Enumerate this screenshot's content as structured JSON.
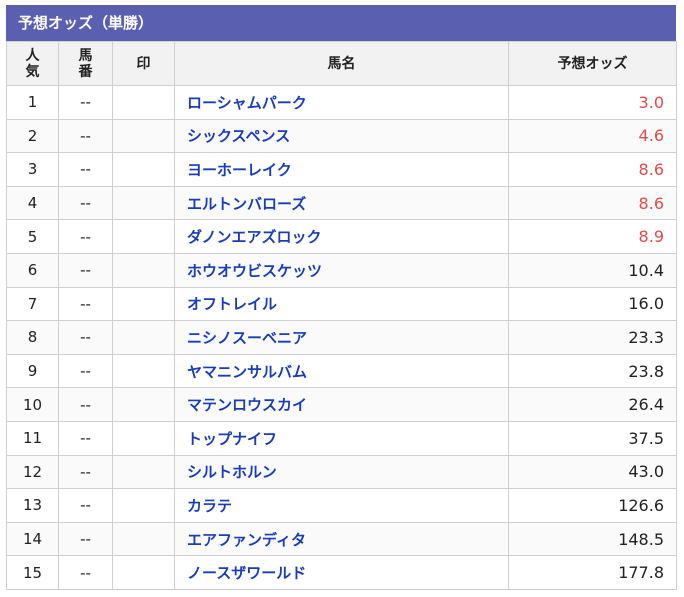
{
  "title": "予想オッズ（単勝）",
  "headers": {
    "rank_line1": "人",
    "rank_line2": "気",
    "num_line1": "馬",
    "num_line2": "番",
    "mark": "印",
    "name": "馬名",
    "odds": "予想オッズ"
  },
  "colors": {
    "header_bar": "#5a5fb0",
    "horse_name": "#1a3cb4",
    "hot_odds": "#e04a4a"
  },
  "rows": [
    {
      "rank": "1",
      "num": "--",
      "mark": "",
      "name": "ローシャムパーク",
      "odds": "3.0",
      "hot": true
    },
    {
      "rank": "2",
      "num": "--",
      "mark": "",
      "name": "シックスペンス",
      "odds": "4.6",
      "hot": true
    },
    {
      "rank": "3",
      "num": "--",
      "mark": "",
      "name": "ヨーホーレイク",
      "odds": "8.6",
      "hot": true
    },
    {
      "rank": "4",
      "num": "--",
      "mark": "",
      "name": "エルトンバローズ",
      "odds": "8.6",
      "hot": true
    },
    {
      "rank": "5",
      "num": "--",
      "mark": "",
      "name": "ダノンエアズロック",
      "odds": "8.9",
      "hot": true
    },
    {
      "rank": "6",
      "num": "--",
      "mark": "",
      "name": "ホウオウビスケッツ",
      "odds": "10.4",
      "hot": false
    },
    {
      "rank": "7",
      "num": "--",
      "mark": "",
      "name": "オフトレイル",
      "odds": "16.0",
      "hot": false
    },
    {
      "rank": "8",
      "num": "--",
      "mark": "",
      "name": "ニシノスーベニア",
      "odds": "23.3",
      "hot": false
    },
    {
      "rank": "9",
      "num": "--",
      "mark": "",
      "name": "ヤマニンサルバム",
      "odds": "23.8",
      "hot": false
    },
    {
      "rank": "10",
      "num": "--",
      "mark": "",
      "name": "マテンロウスカイ",
      "odds": "26.4",
      "hot": false
    },
    {
      "rank": "11",
      "num": "--",
      "mark": "",
      "name": "トップナイフ",
      "odds": "37.5",
      "hot": false
    },
    {
      "rank": "12",
      "num": "--",
      "mark": "",
      "name": "シルトホルン",
      "odds": "43.0",
      "hot": false
    },
    {
      "rank": "13",
      "num": "--",
      "mark": "",
      "name": "カラテ",
      "odds": "126.6",
      "hot": false
    },
    {
      "rank": "14",
      "num": "--",
      "mark": "",
      "name": "エアファンディタ",
      "odds": "148.5",
      "hot": false
    },
    {
      "rank": "15",
      "num": "--",
      "mark": "",
      "name": "ノースザワールド",
      "odds": "177.8",
      "hot": false
    }
  ]
}
